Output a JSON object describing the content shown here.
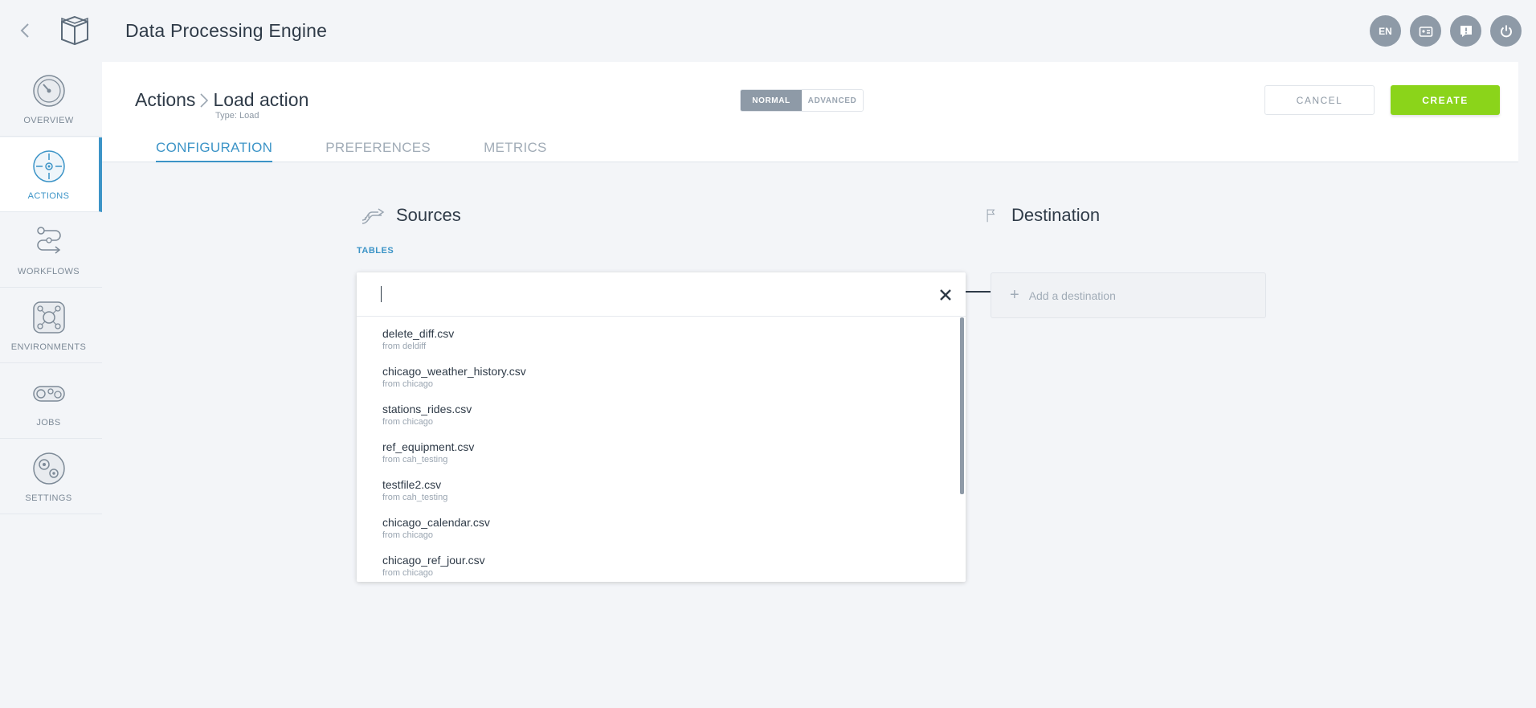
{
  "app": {
    "title": "Data Processing Engine"
  },
  "header_icons": {
    "language": "EN"
  },
  "sidebar": {
    "items": [
      {
        "label": "OVERVIEW"
      },
      {
        "label": "ACTIONS"
      },
      {
        "label": "WORKFLOWS"
      },
      {
        "label": "ENVIRONMENTS"
      },
      {
        "label": "JOBS"
      },
      {
        "label": "SETTINGS"
      }
    ],
    "active": "ACTIONS"
  },
  "page": {
    "breadcrumb_root": "Actions",
    "breadcrumb_current": "Load action",
    "subtitle": "Type: Load"
  },
  "mode": {
    "normal": "NORMAL",
    "advanced": "ADVANCED",
    "selected": "NORMAL"
  },
  "buttons": {
    "cancel": "CANCEL",
    "create": "CREATE"
  },
  "tabs": [
    {
      "label": "CONFIGURATION"
    },
    {
      "label": "PREFERENCES"
    },
    {
      "label": "METRICS"
    }
  ],
  "active_tab": "CONFIGURATION",
  "sources": {
    "title": "Sources",
    "tables_label": "TABLES"
  },
  "search": {
    "value": ""
  },
  "tables": [
    {
      "name": "delete_diff.csv",
      "from": "from deldiff"
    },
    {
      "name": "chicago_weather_history.csv",
      "from": "from chicago"
    },
    {
      "name": "stations_rides.csv",
      "from": "from chicago"
    },
    {
      "name": "ref_equipment.csv",
      "from": "from cah_testing"
    },
    {
      "name": "testfile2.csv",
      "from": "from cah_testing"
    },
    {
      "name": "chicago_calendar.csv",
      "from": "from chicago"
    },
    {
      "name": "chicago_ref_jour.csv",
      "from": "from chicago"
    }
  ],
  "destination": {
    "title": "Destination",
    "add_label": "Add a destination"
  },
  "colors": {
    "accent": "#3c94c7",
    "create": "#8bd41a",
    "mode_on": "#8e9aa7"
  }
}
